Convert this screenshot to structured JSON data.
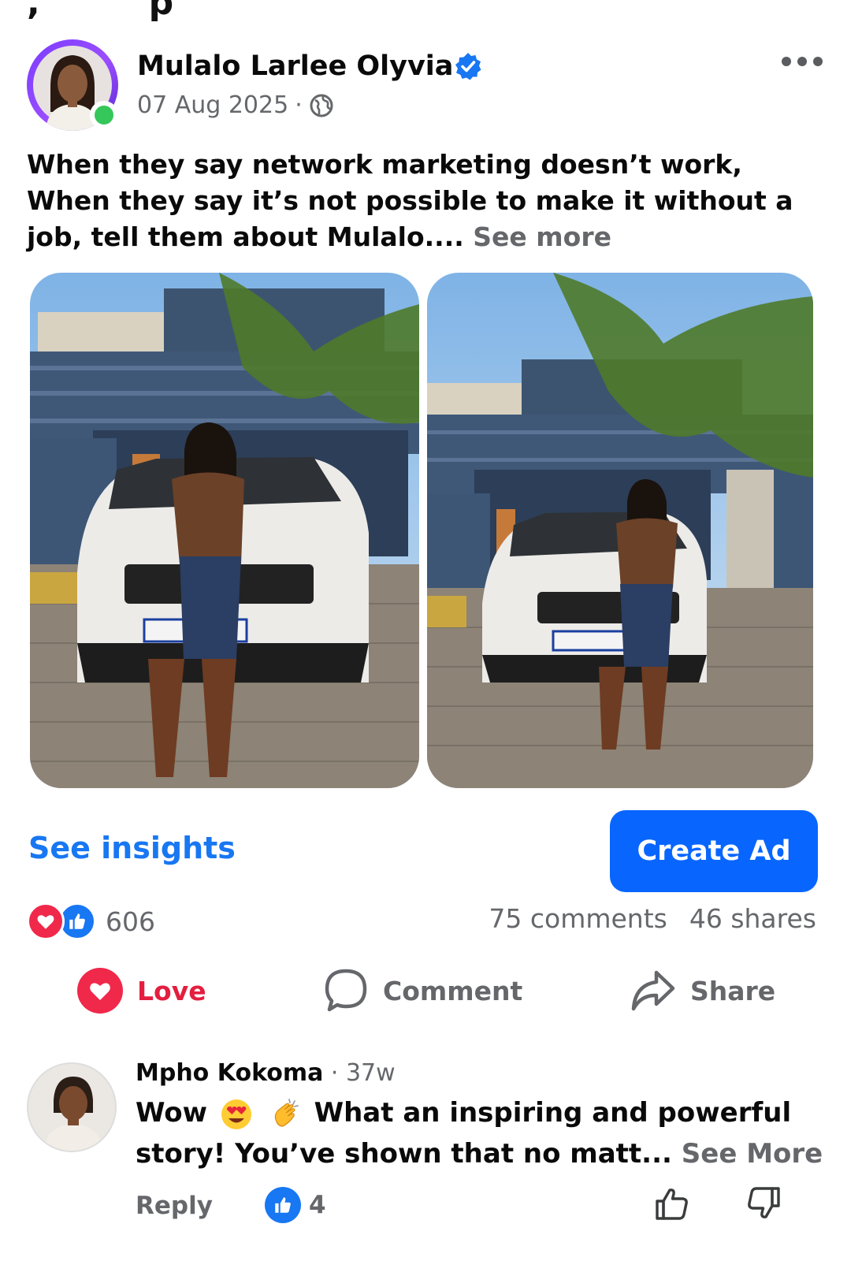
{
  "post": {
    "author": "Mulalo Larlee Olyvia",
    "date": "07 Aug 2025",
    "separator": "·",
    "text_lines": [
      "When they say network marketing doesn’t work,",
      "When they say it’s not possible to make it without a",
      "job, tell  them about Mulalo.... "
    ],
    "see_more": "See more"
  },
  "insights": {
    "see_insights": "See insights",
    "create_ad": "Create Ad"
  },
  "stats": {
    "reactions_count": "606",
    "comments": "75 comments",
    "shares": "46 shares"
  },
  "actions": {
    "love": "Love",
    "comment": "Comment",
    "share": "Share"
  },
  "comment": {
    "name": "Mpho Kokoma",
    "time": " · 37w",
    "text_start": "Wow",
    "text_after_emoji": "What an inspiring and powerful",
    "text_line2": "story! You’ve shown that no matt... ",
    "see_more": "See More",
    "reply": "Reply",
    "like_count": "4"
  },
  "colors": {
    "accent": "#1877f2",
    "create_ad_bg": "#0866ff",
    "love": "#e41e3f",
    "muted": "#65676b",
    "online": "#35c759"
  },
  "icons": [
    "verified-badge-icon",
    "globe-icon",
    "more-options-icon",
    "love-reaction-icon",
    "like-reaction-icon",
    "comment-icon",
    "share-icon",
    "thumb-up-icon",
    "thumb-down-icon",
    "heart-eyes-emoji",
    "clapping-hands-emoji"
  ]
}
